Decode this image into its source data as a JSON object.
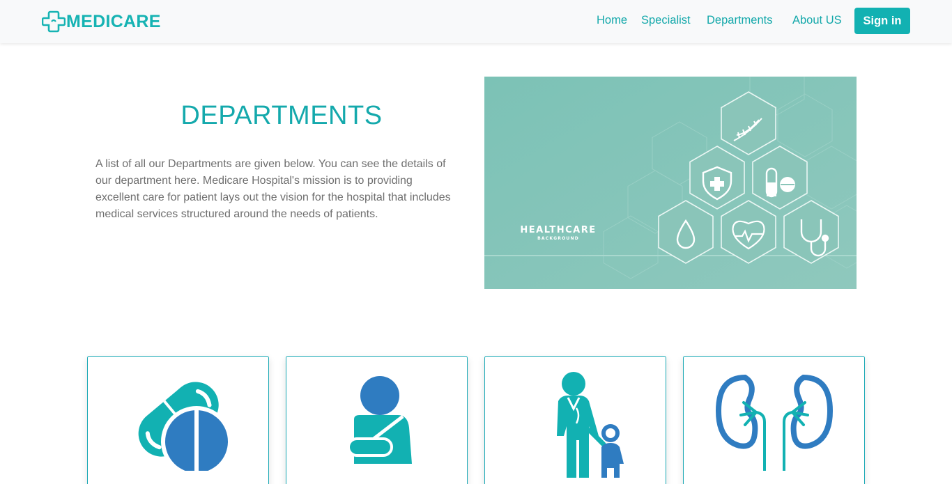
{
  "brand": {
    "name": "MEDICARE",
    "color": "#16b3b3"
  },
  "nav": {
    "links": [
      {
        "label": "Home"
      },
      {
        "label": "Specialist"
      },
      {
        "label": "Departments"
      },
      {
        "label": "About US"
      }
    ],
    "signin_label": "Sign in"
  },
  "hero": {
    "title": "DEPARTMENTS",
    "description": "A list of all our Departments are given below. You can see the details of our department here. Medicare Hospital's mission is to providing excellent care for patient lays out the vision for the hospital that includes medical services structured around the needs of patients.",
    "image": {
      "heading": "HEALTHCARE",
      "subheading": "BACKGROUND",
      "icons": [
        "dna-icon",
        "shield-cross-icon",
        "pills-icon",
        "drop-icon",
        "heart-pulse-icon",
        "stethoscope-icon"
      ]
    }
  },
  "departments": [
    {
      "icon": "medicine-pills-icon"
    },
    {
      "icon": "arm-sling-patient-icon"
    },
    {
      "icon": "doctor-with-child-icon"
    },
    {
      "icon": "kidneys-icon"
    }
  ],
  "colors": {
    "teal": "#12b1b2",
    "blue": "#2f7cc1",
    "image_bg": "#8cc7bc"
  }
}
